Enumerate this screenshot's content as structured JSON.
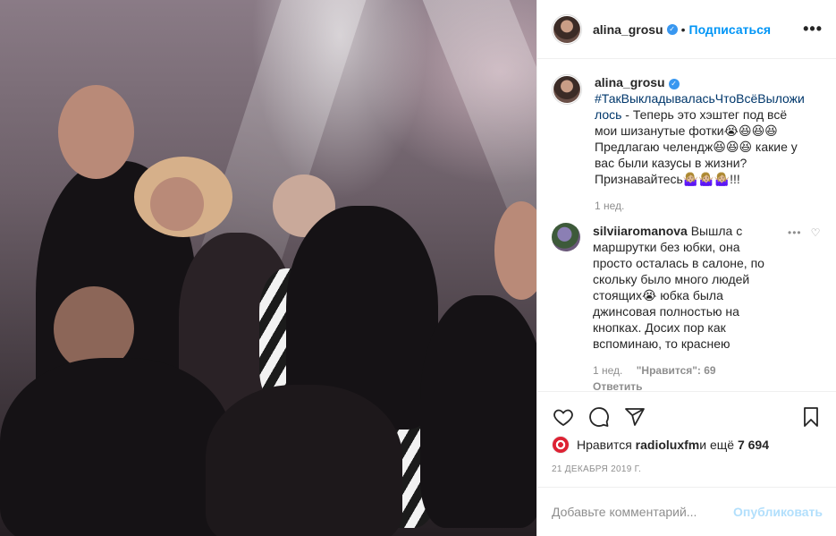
{
  "post": {
    "author": "alina_grosu",
    "follow_label": "Подписаться",
    "more_label": "•••",
    "verified_mark": "✓",
    "separator": "•"
  },
  "caption": {
    "username": "alina_grosu",
    "hashtag": "#ТакВыкладываласьЧтоВсёВыложилось",
    "text": " - Теперь это хэштег под всё мои шизанутые фотки😭😆😆😆 Предлагаю челендж😆😆😆 какие у вас были казусы в жизни? Признавайтесь🤷🏼‍♀️🤷🏼‍♀️🤷🏼‍♀️!!!",
    "time": "1 нед."
  },
  "comment": {
    "username": "silviiaromanova",
    "text": " Вышла с маршрутки без юбки, она просто осталась в салоне, по скольку было много людей стоящих😭 юбка была джинсовая полностью на кнопках. Досих пор как вспоминаю, то краснею",
    "time": "1 нед.",
    "likes": "\"Нравится\": 69",
    "reply": "Ответить",
    "more": "•••",
    "heart": "♡"
  },
  "likes": {
    "prefix": "Нравится ",
    "user": "radioluxfm",
    "suffix": " и ещё ",
    "count": "7 694"
  },
  "date": "21 ДЕКАБРЯ 2019 Г.",
  "add_comment": {
    "placeholder": "Добавьте комментарий...",
    "publish_label": "Опубликовать"
  },
  "icons": [
    "heart-icon",
    "comment-icon",
    "share-icon",
    "bookmark-icon"
  ],
  "colors": {
    "link": "#0095f6",
    "hashtag": "#00376b",
    "muted": "#8e8e8e",
    "publish_disabled": "#b2dffc"
  }
}
